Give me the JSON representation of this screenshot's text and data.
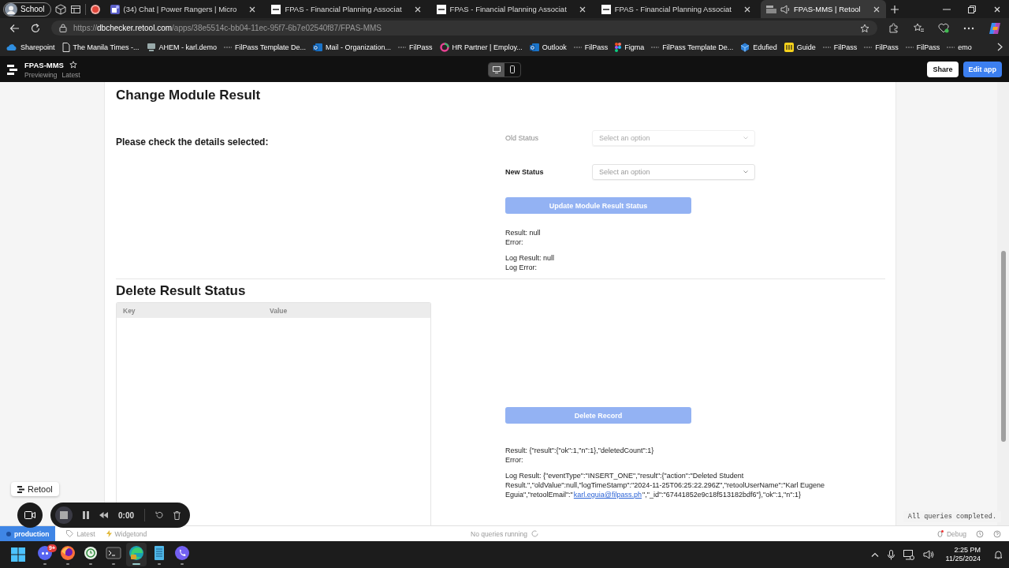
{
  "browser": {
    "profile": "School",
    "tabs": [
      {
        "title": "(34) Chat | Power Rangers | Micro",
        "kind": "chat",
        "selected": false,
        "playing_audio": false
      },
      {
        "title": "FPAS - Financial Planning Associat",
        "kind": "site",
        "selected": false,
        "playing_audio": false
      },
      {
        "title": "FPAS - Financial Planning Associat",
        "kind": "site",
        "selected": false,
        "playing_audio": false
      },
      {
        "title": "FPAS - Financial Planning Associat",
        "kind": "site",
        "selected": false,
        "playing_audio": false
      },
      {
        "title": "FPAS-MMS | Retool",
        "kind": "group",
        "selected": true,
        "playing_audio": true
      }
    ],
    "url": "https://**dbchecker.retool.com**/apps/38e5514c-bb04-11ec-95f7-6b7e02540f87/FPAS-MMS",
    "bookmarks": [
      {
        "label": "Sharepoint",
        "kind": "cloud"
      },
      {
        "label": "The Manila Times -...",
        "kind": "page"
      },
      {
        "label": "AHEM - karl.demo",
        "kind": "server"
      },
      {
        "label": "FilPass Template De...",
        "kind": "dash"
      },
      {
        "label": "Mail - Organization...",
        "kind": "mail"
      },
      {
        "label": "FilPass",
        "kind": "dash"
      },
      {
        "label": "HR Partner | Employ...",
        "kind": "ring"
      },
      {
        "label": "Outlook",
        "kind": "mail"
      },
      {
        "label": "FilPass",
        "kind": "dash"
      },
      {
        "label": "Figma",
        "kind": "figma"
      },
      {
        "label": "FilPass Template De...",
        "kind": "dash"
      },
      {
        "label": "Edufied",
        "kind": "cube"
      },
      {
        "label": "Guide",
        "kind": "guide"
      },
      {
        "label": "FilPass",
        "kind": "dash"
      },
      {
        "label": "FilPass",
        "kind": "dash"
      },
      {
        "label": "FilPass",
        "kind": "dash"
      },
      {
        "label": "emo",
        "kind": "dash"
      }
    ]
  },
  "app_header": {
    "title": "FPAS-MMS",
    "mode": "Previewing",
    "version": "Latest",
    "view_modes": [
      {
        "kind": "desktop",
        "selected": true
      },
      {
        "kind": "mobile",
        "selected": false
      }
    ],
    "buttons": [
      {
        "label": "Share",
        "kind": "secondary"
      },
      {
        "label": "Edit app",
        "kind": "primary"
      }
    ]
  },
  "change_module_result": {
    "title": "Change Module Result",
    "prompt": "Please check the details selected:",
    "fields": [
      {
        "label": "Old Status",
        "placeholder": "Select an option",
        "disabled": true
      },
      {
        "label": "New Status",
        "placeholder": "Select an option",
        "disabled": false
      }
    ],
    "button": {
      "label": "Update Module Result Status",
      "disabled": true
    },
    "outputs": [
      [
        "Result: null",
        "Error:"
      ],
      [
        "Log Result: null",
        "Log Error:"
      ]
    ]
  },
  "delete_result_status": {
    "title": "Delete Result Status",
    "table": {
      "columns": [
        "Key",
        "Value"
      ]
    },
    "button": {
      "label": "Delete Record",
      "disabled": true
    },
    "result": [
      "Result: {\"result\":{\"ok\":1,\"n\":1},\"deletedCount\":1}",
      "Error:"
    ],
    "log_result": {
      "lines": [
        "Log Result: {\"eventType\":\"INSERT_ONE\",\"result\":{\"action\":\"Deleted Student",
        "Result.\",\"oldValue\":null,\"logTimeStamp\":\"2024-11-25T06:25:22.296Z\",\"retoolUserName\":\"Karl Eugene"
      ],
      "before": "Eguia\",\"retoolEmail\":\"",
      "link": "karl.eguia@filpass.ph",
      "after": "\",\"_id\":\"67441852e9c18f513182bdf6\"},\"ok\":1,\"n\":1}"
    }
  },
  "console_message": "All queries completed.",
  "retool_badge": "Retool",
  "footer": {
    "environment": "production",
    "items": [
      {
        "label": "Latest",
        "kind": "tag"
      },
      {
        "label": "Widgetond",
        "kind": "bolt"
      }
    ],
    "status": "No queries running",
    "debug": "Debug"
  },
  "recorder": {
    "time": "0:00"
  },
  "taskbar": {
    "apps": [
      {
        "kind": "chat",
        "badge": "9+",
        "selected": false
      },
      {
        "kind": "browser",
        "selected": false
      },
      {
        "kind": "clock",
        "selected": false
      },
      {
        "kind": "terminal",
        "selected": false
      },
      {
        "kind": "edge",
        "selected": true
      },
      {
        "kind": "notes",
        "selected": false
      },
      {
        "kind": "phone",
        "selected": false
      }
    ],
    "time": "2:25 PM",
    "date": "11/25/2024"
  }
}
